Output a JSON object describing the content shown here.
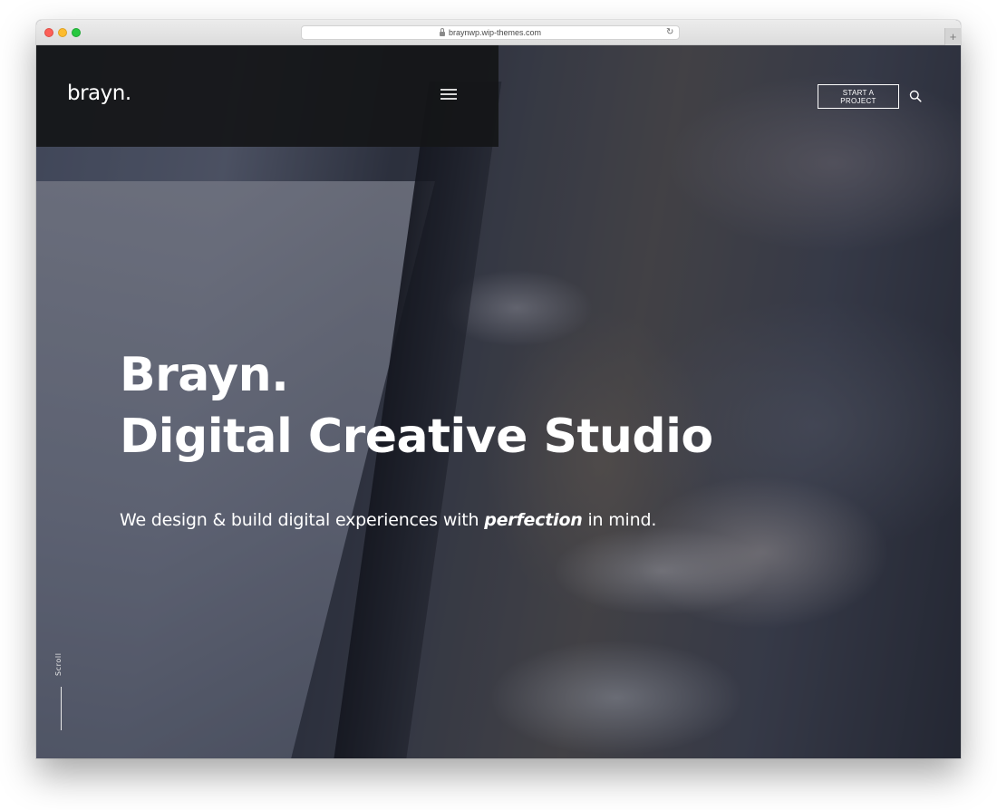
{
  "browser": {
    "url": "braynwp.wip-themes.com"
  },
  "header": {
    "logo": "brayn.",
    "cta_label": "START A PROJECT"
  },
  "hero": {
    "title_line1": "Brayn.",
    "title_line2": "Digital Creative Studio",
    "subtitle_before": "We design & build digital experiences with ",
    "subtitle_emphasis": "perfection",
    "subtitle_after": " in mind.",
    "scroll_label": "Scroll"
  },
  "icons": {
    "menu": "hamburger-icon",
    "search": "search-icon",
    "lock": "lock-icon",
    "reload": "reload-icon",
    "new_tab": "plus-icon"
  },
  "colors": {
    "header_panel": "#141518",
    "text": "#ffffff",
    "overlay": "#141824"
  }
}
